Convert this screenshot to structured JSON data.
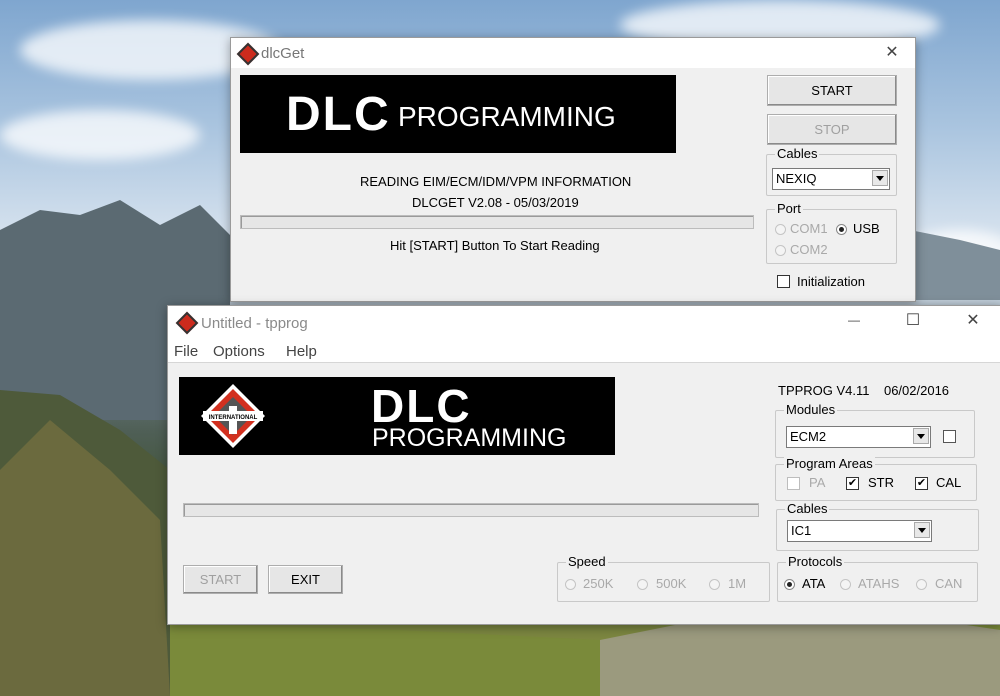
{
  "dlcget": {
    "title": "dlcGet",
    "close_glyph": "✕",
    "banner": {
      "brand": "DLC",
      "text": "PROGRAMMING"
    },
    "info_line1": "READING EIM/ECM/IDM/VPM INFORMATION",
    "info_line2": "DLCGET V2.08 - 05/03/2019",
    "progress": 0,
    "status": "Hit [START] Button To Start Reading",
    "start_label": "START",
    "stop_label": "STOP",
    "cables": {
      "label": "Cables",
      "selected": "NEXIQ"
    },
    "port": {
      "label": "Port",
      "options": [
        {
          "label": "COM1",
          "selected": false,
          "enabled": false
        },
        {
          "label": "USB",
          "selected": true,
          "enabled": true
        },
        {
          "label": "COM2",
          "selected": false,
          "enabled": false
        }
      ]
    },
    "initialization": {
      "label": "Initialization",
      "checked": false
    }
  },
  "tpprog": {
    "title": "Untitled - tpprog",
    "minimize_glyph": "—",
    "maximize_glyph": "☐",
    "close_glyph": "✕",
    "menu": [
      "File",
      "Options",
      "Help"
    ],
    "banner": {
      "emblem": "INTERNATIONAL",
      "brand": "DLC",
      "text": "PROGRAMMING"
    },
    "version": "TPPROG V4.11    06/02/2016",
    "modules": {
      "label": "Modules",
      "selected": "ECM2",
      "checked": false
    },
    "program_areas": {
      "label": "Program Areas",
      "items": [
        {
          "label": "PA",
          "checked": false,
          "enabled": false
        },
        {
          "label": "STR",
          "checked": true,
          "enabled": true
        },
        {
          "label": "CAL",
          "checked": true,
          "enabled": true
        }
      ]
    },
    "cables": {
      "label": "Cables",
      "selected": "IC1"
    },
    "progress": 0,
    "start_label": "START",
    "exit_label": "EXIT",
    "speed": {
      "label": "Speed",
      "options": [
        {
          "label": "250K",
          "selected": false
        },
        {
          "label": "500K",
          "selected": false
        },
        {
          "label": "1M",
          "selected": false
        }
      ]
    },
    "protocols": {
      "label": "Protocols",
      "options": [
        {
          "label": "ATA",
          "selected": true,
          "enabled": true
        },
        {
          "label": "ATAHS",
          "selected": false,
          "enabled": false
        },
        {
          "label": "CAN",
          "selected": false,
          "enabled": false
        }
      ]
    },
    "check_glyph": "✔"
  }
}
